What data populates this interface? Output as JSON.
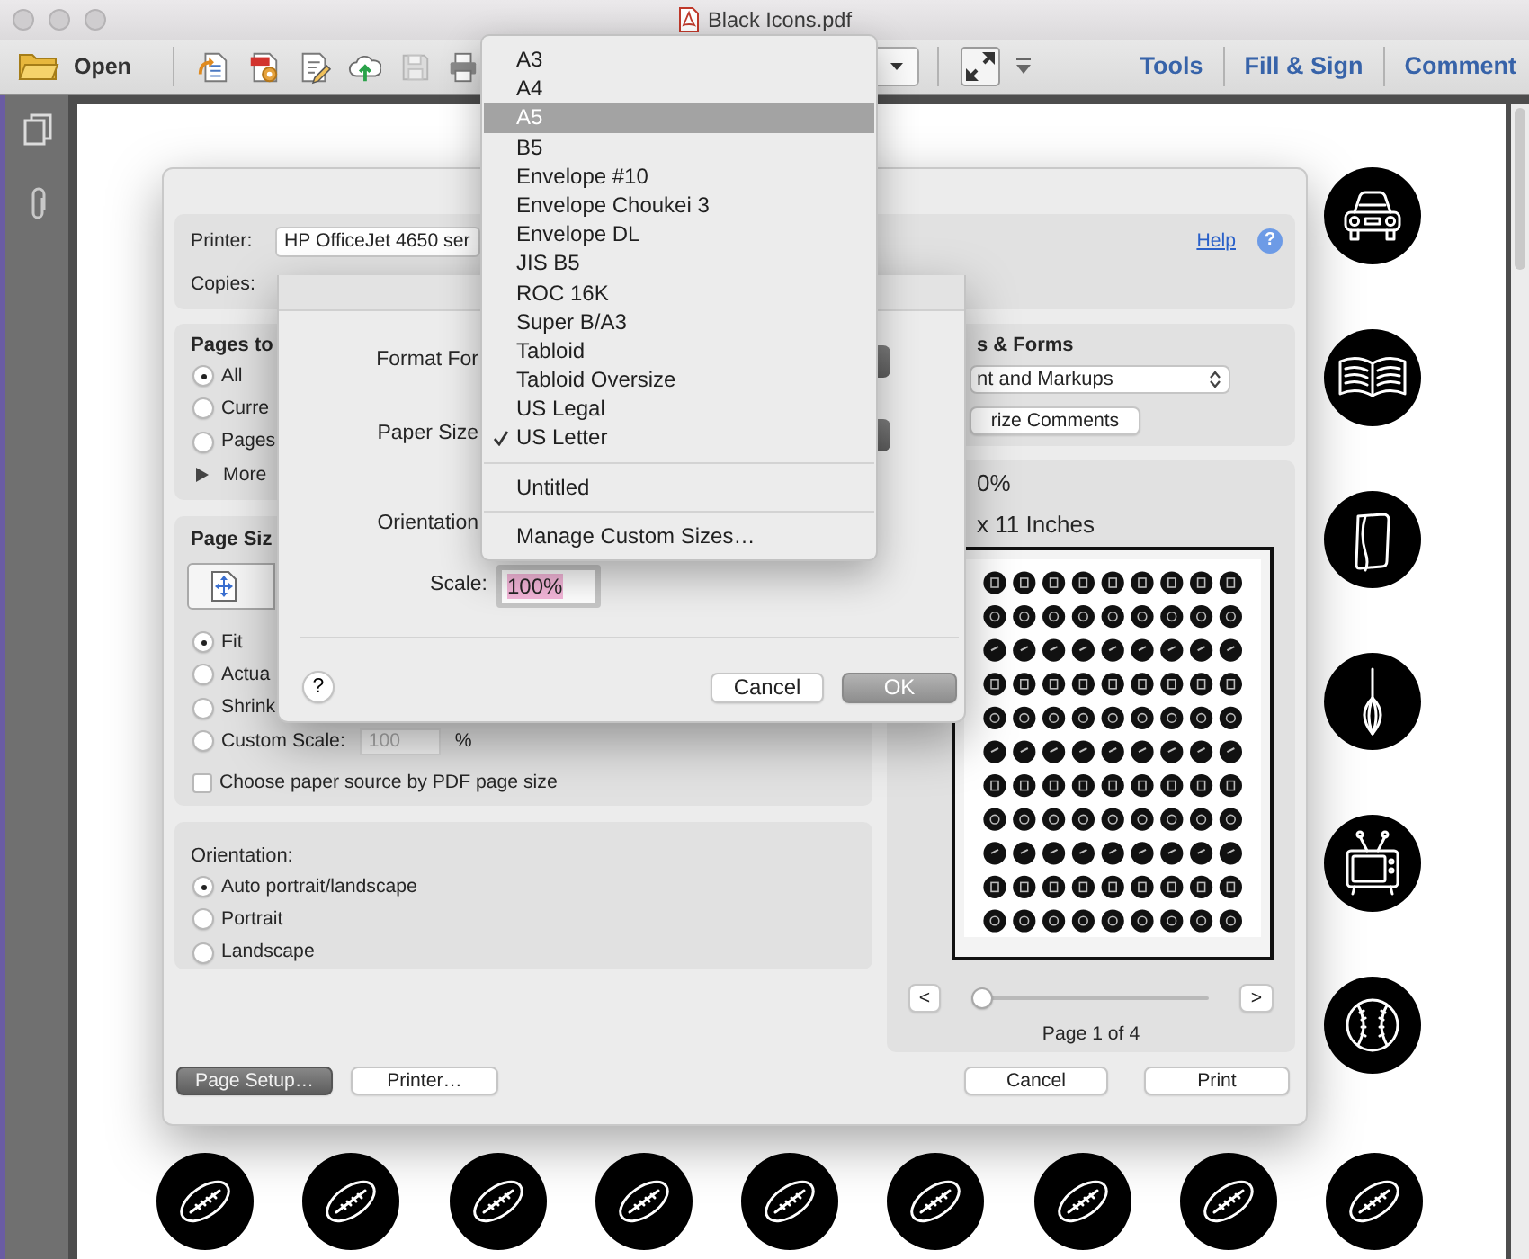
{
  "window": {
    "title": "Black Icons.pdf"
  },
  "toolbar": {
    "open": "Open",
    "links": [
      "Tools",
      "Fill & Sign",
      "Comment"
    ]
  },
  "print_dialog": {
    "printer": {
      "label": "Printer:",
      "value": "HP OfficeJet 4650 ser"
    },
    "copies": {
      "label": "Copies:"
    },
    "help_link": "Help",
    "help_button": "?",
    "pages": {
      "title": "Pages to",
      "options": [
        {
          "label": "All",
          "selected": true
        },
        {
          "label": "Curre",
          "selected": false
        },
        {
          "label": "Pages",
          "selected": false
        }
      ],
      "more": {
        "label": "More",
        "expanded": false
      }
    },
    "page_sizing": {
      "title": "Page Siz",
      "options": [
        {
          "label": "Fit",
          "selected": true
        },
        {
          "label": "Actua",
          "selected": false
        },
        {
          "label": "Shrink",
          "selected": false
        },
        {
          "label": "Custom Scale:",
          "selected": false,
          "field": {
            "value": "100",
            "unit": "%",
            "disabled": true
          }
        }
      ],
      "paper_source": {
        "label": "Choose paper source by PDF page size",
        "checked": false
      }
    },
    "orientation": {
      "title": "Orientation:",
      "options": [
        {
          "label": "Auto portrait/landscape",
          "selected": true
        },
        {
          "label": "Portrait",
          "selected": false
        },
        {
          "label": "Landscape",
          "selected": false
        }
      ]
    },
    "comments_forms": {
      "title": "s & Forms",
      "select": "nt and Markups",
      "button": "rize Comments"
    },
    "preview": {
      "scale": "0%",
      "size": "x 11 Inches",
      "prev": "<",
      "next": ">",
      "slider": {
        "level": 0
      },
      "page": "Page 1 of 4"
    },
    "left_buttons": [
      {
        "label": "Page Setup…",
        "pressed": true
      },
      {
        "label": "Printer…",
        "pressed": false
      }
    ],
    "right_buttons": [
      {
        "label": "Cancel",
        "pressed": false
      },
      {
        "label": "Print",
        "pressed": false
      }
    ]
  },
  "page_setup": {
    "format_for": "Format For",
    "paper_size": "Paper Size",
    "orientation": "Orientation",
    "scale": {
      "label": "Scale:",
      "value": "100%"
    },
    "help": "?",
    "buttons": [
      {
        "label": "Cancel",
        "default": false
      },
      {
        "label": "OK",
        "default": true
      }
    ]
  },
  "paper_size_menu": {
    "groups": [
      [
        {
          "label": "A3",
          "selected": false,
          "checked": false
        },
        {
          "label": "A4",
          "selected": false,
          "checked": false
        },
        {
          "label": "A5",
          "selected": true,
          "checked": false
        },
        {
          "label": "B5",
          "selected": false,
          "checked": false
        },
        {
          "label": "Envelope #10",
          "selected": false,
          "checked": false
        },
        {
          "label": "Envelope Choukei 3",
          "selected": false,
          "checked": false
        },
        {
          "label": "Envelope DL",
          "selected": false,
          "checked": false
        },
        {
          "label": "JIS B5",
          "selected": false,
          "checked": false
        },
        {
          "label": "ROC 16K",
          "selected": false,
          "checked": false
        },
        {
          "label": "Super B/A3",
          "selected": false,
          "checked": false
        },
        {
          "label": "Tabloid",
          "selected": false,
          "checked": false
        },
        {
          "label": "Tabloid Oversize",
          "selected": false,
          "checked": false
        },
        {
          "label": "US Legal",
          "selected": false,
          "checked": false
        },
        {
          "label": "US Letter",
          "selected": false,
          "checked": true
        }
      ],
      [
        {
          "label": "Untitled",
          "selected": false,
          "checked": false
        }
      ],
      [
        {
          "label": "Manage Custom Sizes…",
          "selected": false,
          "checked": false
        }
      ]
    ]
  }
}
